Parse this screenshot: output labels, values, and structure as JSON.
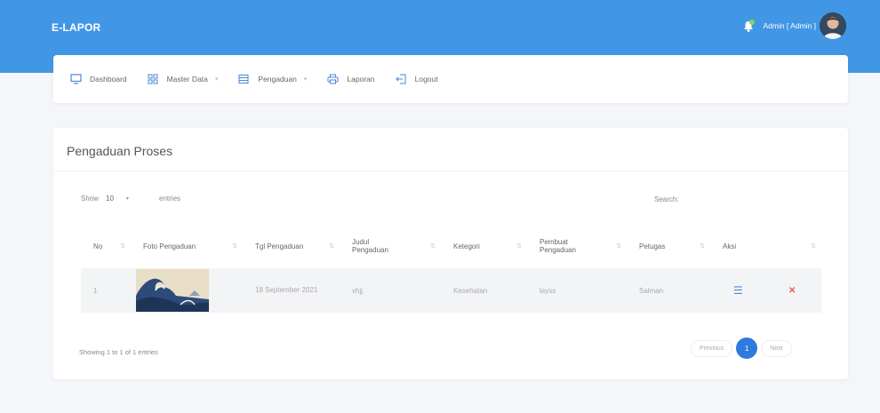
{
  "app": {
    "brand": "E-LAPOR",
    "user_label": "Admin [ Admin ]"
  },
  "nav": [
    {
      "label": "Dashboard",
      "icon": "monitor-icon",
      "dropdown": false
    },
    {
      "label": "Master Data",
      "icon": "grid-icon",
      "dropdown": true
    },
    {
      "label": "Pengaduan",
      "icon": "list-icon",
      "dropdown": true
    },
    {
      "label": "Laporan",
      "icon": "printer-icon",
      "dropdown": false
    },
    {
      "label": "Logout",
      "icon": "logout-icon",
      "dropdown": false
    }
  ],
  "card": {
    "title": "Pengaduan Proses",
    "length": {
      "show_label": "Show",
      "value": "10",
      "entries_label": "entries"
    },
    "search": {
      "label": "Search:",
      "value": ""
    },
    "columns": [
      {
        "label": "No",
        "sort": true
      },
      {
        "label": "Foto Pengaduan",
        "sort": true
      },
      {
        "label": "Tgl Pengaduan",
        "sort": true
      },
      {
        "label": "Judul Pengaduan",
        "sort": true
      },
      {
        "label": "Ketegori",
        "sort": true
      },
      {
        "label": "Pembuat Pengaduan",
        "sort": true
      },
      {
        "label": "Petugas",
        "sort": true
      },
      {
        "label": "Aksi",
        "sort": false
      },
      {
        "label": "",
        "sort": true
      }
    ],
    "rows": [
      {
        "no": "1",
        "tgl": "18 September 2021",
        "judul": "vhjj",
        "kategori": "Kesehatan",
        "pembuat": "layss",
        "petugas": "Salman"
      }
    ],
    "info": "Showing 1 to 1 of 1 entries",
    "pagination": {
      "previous": "Previous",
      "current": "1",
      "next": "Next"
    }
  },
  "colors": {
    "primary": "#4296e6",
    "page_active": "#2f7ae0",
    "delete": "#e85a5a",
    "edit": "#4a86d9"
  }
}
